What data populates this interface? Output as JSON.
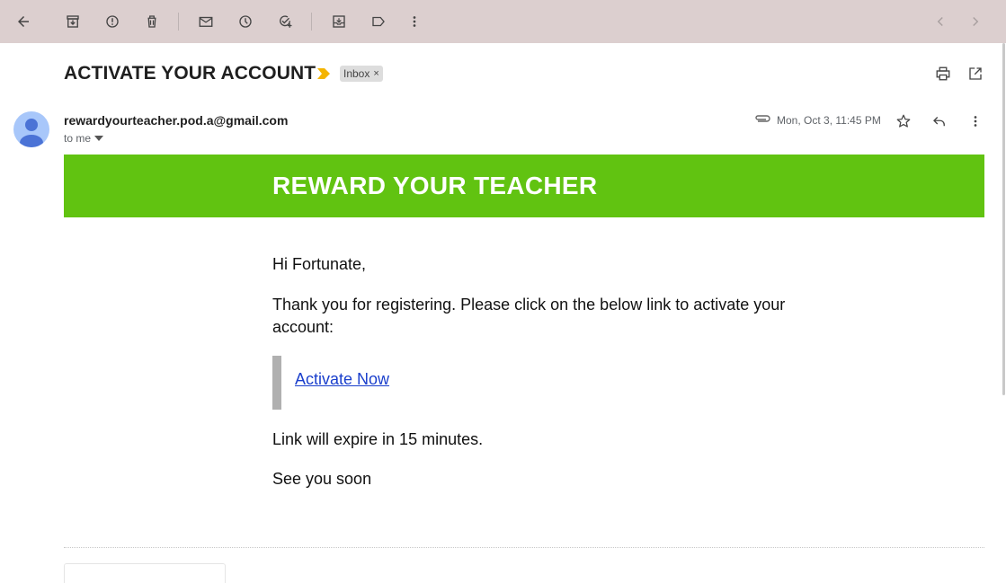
{
  "toolbar": {
    "icons": [
      "back-arrow-icon",
      "archive-icon",
      "report-spam-icon",
      "delete-icon",
      "mark-unread-icon",
      "snooze-icon",
      "add-task-icon",
      "move-to-icon",
      "label-icon",
      "more-vert-icon",
      "prev-chevron-icon",
      "next-chevron-icon"
    ]
  },
  "email": {
    "subject": "ACTIVATE YOUR ACCOUNT",
    "label_chip": "Inbox",
    "chip_close": "×",
    "sender": "rewardyourteacher.pod.a@gmail.com",
    "recipient": "to me",
    "date": "Mon, Oct 3, 11:45 PM"
  },
  "body": {
    "banner_title": "REWARD YOUR TEACHER",
    "greeting": "Hi Fortunate,",
    "message": "Thank you for registering. Please click on the below link to activate your account:",
    "link_text": "Activate Now",
    "expiry": "Link will expire in 15 minutes.",
    "signoff": "See you soon"
  },
  "colors": {
    "banner": "#61c311",
    "toolbar": "#dccfcf",
    "link": "#1a3fcc",
    "importance": "#f4b400"
  }
}
